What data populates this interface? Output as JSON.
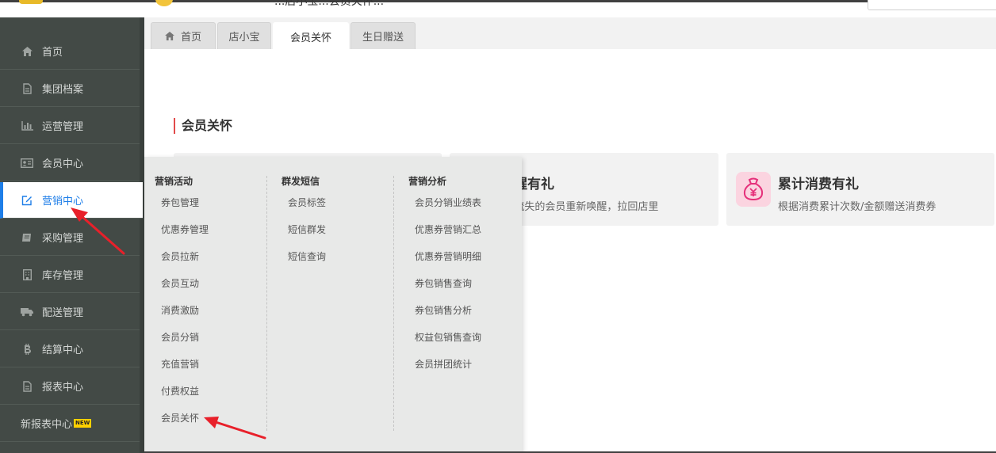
{
  "header": {
    "title_fragment": "...店小宝...会员关怀..."
  },
  "sidebar": {
    "items": [
      {
        "label": "首页",
        "icon": "home-icon"
      },
      {
        "label": "集团档案",
        "icon": "file-icon"
      },
      {
        "label": "运营管理",
        "icon": "bar-chart-icon"
      },
      {
        "label": "会员中心",
        "icon": "id-card-icon"
      },
      {
        "label": "营销中心",
        "icon": "edit-icon",
        "active": true
      },
      {
        "label": "采购管理",
        "icon": "book-icon"
      },
      {
        "label": "库存管理",
        "icon": "building-icon"
      },
      {
        "label": "配送管理",
        "icon": "truck-icon"
      },
      {
        "label": "结算中心",
        "icon": "bitcoin-icon"
      },
      {
        "label": "报表中心",
        "icon": "report-icon"
      },
      {
        "label": "新报表中心",
        "badge": "NEW"
      }
    ]
  },
  "tabs": [
    {
      "label": "首页",
      "icon": "home-icon"
    },
    {
      "label": "店小宝"
    },
    {
      "label": "会员关怀",
      "active": true
    },
    {
      "label": "生日赠送"
    }
  ],
  "content": {
    "section_title": "会员关怀",
    "cards": [
      {
        "title": "醒有礼",
        "desc": "沉睡/流失的会员重新唤醒，拉回店里"
      },
      {
        "title": "累计消费有礼",
        "desc": "根据消费累计次数/金额赠送消费券",
        "icon": "money-bag-icon"
      }
    ]
  },
  "mega_menu": {
    "columns": [
      {
        "header": "营销活动",
        "items": [
          "券包管理",
          "优惠券管理",
          "会员拉新",
          "会员互动",
          "消费激励",
          "会员分销",
          "充值营销",
          "付费权益",
          "会员关怀"
        ]
      },
      {
        "header": "群发短信",
        "items": [
          "会员标签",
          "短信群发",
          "短信查询"
        ]
      },
      {
        "header": "营销分析",
        "items": [
          "会员分销业绩表",
          "优惠券营销汇总",
          "优惠券营销明细",
          "券包销售查询",
          "券包销售分析",
          "权益包销售查询",
          "会员拼团统计"
        ]
      }
    ]
  },
  "colors": {
    "sidebar_bg": "#434a46",
    "active_blue": "#1e7ee8",
    "arrow_red": "#e8202a",
    "menu_bg": "#e8e9e8",
    "card_bg": "#f2f2f2",
    "title_accent": "#e24a4a",
    "badge_yellow": "#ffd000"
  }
}
